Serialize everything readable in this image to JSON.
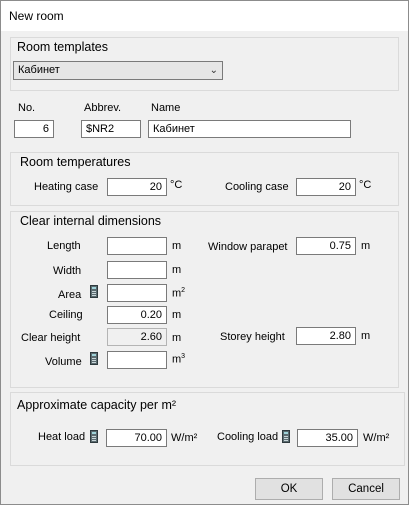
{
  "window": {
    "title": "New room"
  },
  "templates": {
    "group_title": "Room templates",
    "selected": "Кабинет"
  },
  "id": {
    "no_label": "No.",
    "abbrev_label": "Abbrev.",
    "name_label": "Name",
    "no_value": "6",
    "abbrev_value": "$NR2",
    "name_value": "Кабинет"
  },
  "temperatures": {
    "group_title": "Room temperatures",
    "heating_label": "Heating case",
    "heating_value": "20",
    "cooling_label": "Cooling case",
    "cooling_value": "20",
    "unit": "°C"
  },
  "dimensions": {
    "group_title": "Clear internal dimensions",
    "length_label": "Length",
    "length_value": "",
    "width_label": "Width",
    "width_value": "",
    "area_label": "Area",
    "area_value": "",
    "ceiling_label": "Ceiling",
    "ceiling_value": "0.20",
    "clear_height_label": "Clear height",
    "clear_height_value": "2.60",
    "volume_label": "Volume",
    "volume_value": "",
    "window_parapet_label": "Window parapet",
    "window_parapet_value": "0.75",
    "storey_height_label": "Storey height",
    "storey_height_value": "2.80",
    "unit_m": "m",
    "unit_m_base": "m",
    "unit_sq_exp": "2",
    "unit_cu_exp": "3"
  },
  "capacity": {
    "group_title": "Approximate capacity per m²",
    "heat_label": "Heat load",
    "heat_value": "70.00",
    "cooling_label": "Cooling load",
    "cooling_value": "35.00",
    "unit": "W/m²"
  },
  "buttons": {
    "ok": "OK",
    "cancel": "Cancel"
  },
  "icons": {
    "calculator": "calculator-icon",
    "dropdown": "chevron-down-icon"
  }
}
